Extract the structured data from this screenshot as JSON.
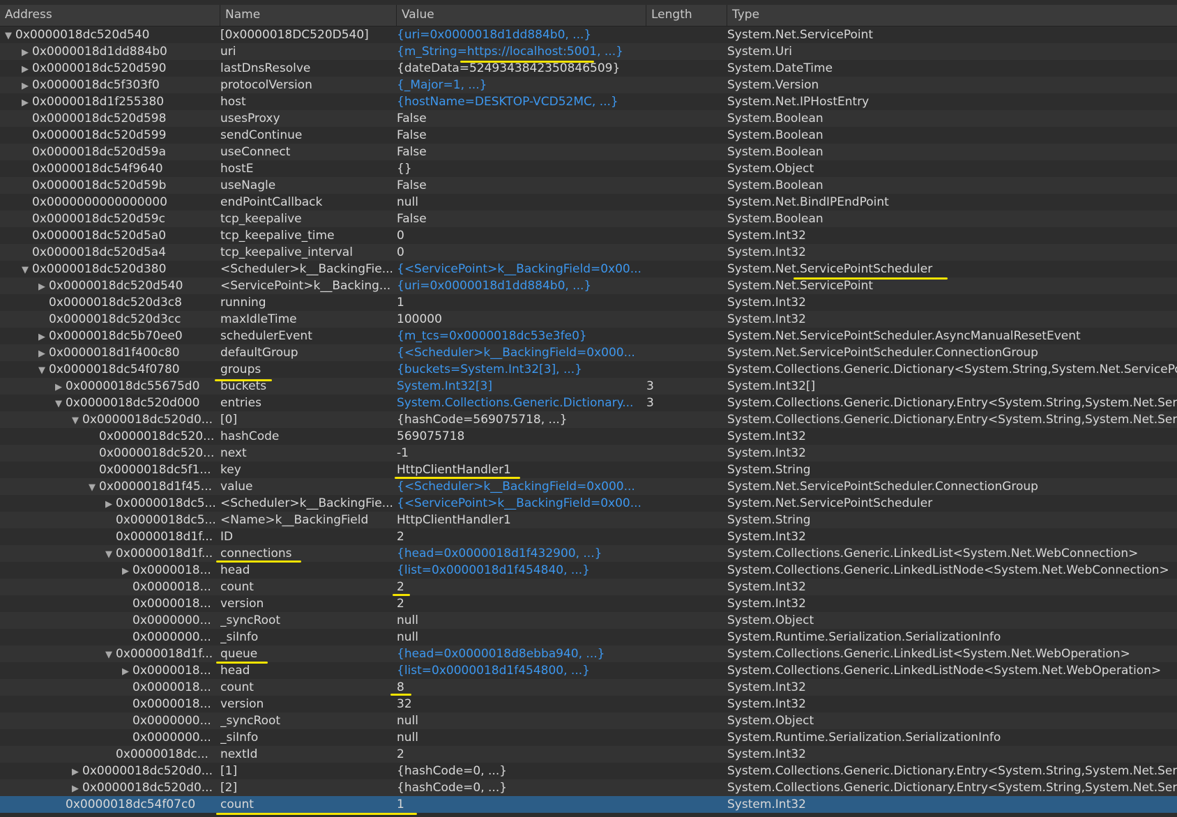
{
  "columns": [
    "Address",
    "Name",
    "Value",
    "Length",
    "Type"
  ],
  "rows": [
    {
      "depth": 0,
      "toggle": "open",
      "addr": "0x0000018dc520d540",
      "name": "[0x0000018DC520D540]",
      "value": "{uri=0x0000018d1dd884b0, ...}",
      "link": true,
      "len": "",
      "type": "System.Net.ServicePoint"
    },
    {
      "depth": 1,
      "toggle": "closed",
      "addr": "0x0000018d1dd884b0",
      "name": "uri",
      "value": "{m_String=https://localhost:5001, ...}",
      "link": true,
      "len": "",
      "type": "System.Uri"
    },
    {
      "depth": 1,
      "toggle": "closed",
      "addr": "0x0000018dc520d590",
      "name": "lastDnsResolve",
      "value": "{dateData=5249343842350846509}",
      "link": false,
      "len": "",
      "type": "System.DateTime"
    },
    {
      "depth": 1,
      "toggle": "closed",
      "addr": "0x0000018dc5f303f0",
      "name": "protocolVersion",
      "value": "{_Major=1, ...}",
      "link": true,
      "len": "",
      "type": "System.Version"
    },
    {
      "depth": 1,
      "toggle": "closed",
      "addr": "0x0000018d1f255380",
      "name": "host",
      "value": "{hostName=DESKTOP-VCD52MC, ...}",
      "link": true,
      "len": "",
      "type": "System.Net.IPHostEntry"
    },
    {
      "depth": 1,
      "toggle": "none",
      "addr": "0x0000018dc520d598",
      "name": "usesProxy",
      "value": "False",
      "link": false,
      "len": "",
      "type": "System.Boolean"
    },
    {
      "depth": 1,
      "toggle": "none",
      "addr": "0x0000018dc520d599",
      "name": "sendContinue",
      "value": "False",
      "link": false,
      "len": "",
      "type": "System.Boolean"
    },
    {
      "depth": 1,
      "toggle": "none",
      "addr": "0x0000018dc520d59a",
      "name": "useConnect",
      "value": "False",
      "link": false,
      "len": "",
      "type": "System.Boolean"
    },
    {
      "depth": 1,
      "toggle": "none",
      "addr": "0x0000018dc54f9640",
      "name": "hostE",
      "value": "{}",
      "link": false,
      "len": "",
      "type": "System.Object"
    },
    {
      "depth": 1,
      "toggle": "none",
      "addr": "0x0000018dc520d59b",
      "name": "useNagle",
      "value": "False",
      "link": false,
      "len": "",
      "type": "System.Boolean"
    },
    {
      "depth": 1,
      "toggle": "none",
      "addr": "0x0000000000000000",
      "name": "endPointCallback",
      "value": "null",
      "link": false,
      "len": "",
      "type": "System.Net.BindIPEndPoint"
    },
    {
      "depth": 1,
      "toggle": "none",
      "addr": "0x0000018dc520d59c",
      "name": "tcp_keepalive",
      "value": "False",
      "link": false,
      "len": "",
      "type": "System.Boolean"
    },
    {
      "depth": 1,
      "toggle": "none",
      "addr": "0x0000018dc520d5a0",
      "name": "tcp_keepalive_time",
      "value": "0",
      "link": false,
      "len": "",
      "type": "System.Int32"
    },
    {
      "depth": 1,
      "toggle": "none",
      "addr": "0x0000018dc520d5a4",
      "name": "tcp_keepalive_interval",
      "value": "0",
      "link": false,
      "len": "",
      "type": "System.Int32"
    },
    {
      "depth": 1,
      "toggle": "open",
      "addr": "0x0000018dc520d380",
      "name": "<Scheduler>k__BackingFie...",
      "value": "{<ServicePoint>k__BackingField=0x00...",
      "link": true,
      "len": "",
      "type": "System.Net.ServicePointScheduler"
    },
    {
      "depth": 2,
      "toggle": "closed",
      "addr": "0x0000018dc520d540",
      "name": "<ServicePoint>k__Backing...",
      "value": "{uri=0x0000018d1dd884b0, ...}",
      "link": true,
      "len": "",
      "type": "System.Net.ServicePoint"
    },
    {
      "depth": 2,
      "toggle": "none",
      "addr": "0x0000018dc520d3c8",
      "name": "running",
      "value": "1",
      "link": false,
      "len": "",
      "type": "System.Int32"
    },
    {
      "depth": 2,
      "toggle": "none",
      "addr": "0x0000018dc520d3cc",
      "name": "maxIdleTime",
      "value": "100000",
      "link": false,
      "len": "",
      "type": "System.Int32"
    },
    {
      "depth": 2,
      "toggle": "closed",
      "addr": "0x0000018dc5b70ee0",
      "name": "schedulerEvent",
      "value": "{m_tcs=0x0000018dc53e3fe0}",
      "link": true,
      "len": "",
      "type": "System.Net.ServicePointScheduler.AsyncManualResetEvent"
    },
    {
      "depth": 2,
      "toggle": "closed",
      "addr": "0x0000018d1f400c80",
      "name": "defaultGroup",
      "value": "{<Scheduler>k__BackingField=0x000...",
      "link": true,
      "len": "",
      "type": "System.Net.ServicePointScheduler.ConnectionGroup"
    },
    {
      "depth": 2,
      "toggle": "open",
      "addr": "0x0000018dc54f0780",
      "name": "groups",
      "value": "{buckets=System.Int32[3], ...}",
      "link": true,
      "len": "",
      "type": "System.Collections.Generic.Dictionary<System.String,System.Net.ServicePointScheduler.ConnectionGroup>"
    },
    {
      "depth": 3,
      "toggle": "closed",
      "addr": "0x0000018dc55675d0",
      "name": "buckets",
      "value": "System.Int32[3]",
      "link": true,
      "len": "3",
      "type": "System.Int32[]"
    },
    {
      "depth": 3,
      "toggle": "open",
      "addr": "0x0000018dc520d000",
      "name": "entries",
      "value": "System.Collections.Generic.Dictionary...",
      "link": true,
      "len": "3",
      "type": "System.Collections.Generic.Dictionary.Entry<System.String,System.Net.ServicePointScheduler.ConnectionGroup>[]"
    },
    {
      "depth": 4,
      "toggle": "open",
      "addr": "0x0000018dc520d0...",
      "name": "[0]",
      "value": "{hashCode=569075718, ...}",
      "link": false,
      "len": "",
      "type": "System.Collections.Generic.Dictionary.Entry<System.String,System.Net.ServicePointScheduler.ConnectionGroup>"
    },
    {
      "depth": 5,
      "toggle": "none",
      "addr": "0x0000018dc520...",
      "name": "hashCode",
      "value": "569075718",
      "link": false,
      "len": "",
      "type": "System.Int32"
    },
    {
      "depth": 5,
      "toggle": "none",
      "addr": "0x0000018dc520...",
      "name": "next",
      "value": "-1",
      "link": false,
      "len": "",
      "type": "System.Int32"
    },
    {
      "depth": 5,
      "toggle": "none",
      "addr": "0x0000018dc5f1...",
      "name": "key",
      "value": "HttpClientHandler1",
      "link": false,
      "len": "",
      "type": "System.String"
    },
    {
      "depth": 5,
      "toggle": "open",
      "addr": "0x0000018d1f45...",
      "name": "value",
      "value": "{<Scheduler>k__BackingField=0x000...",
      "link": true,
      "len": "",
      "type": "System.Net.ServicePointScheduler.ConnectionGroup"
    },
    {
      "depth": 6,
      "toggle": "closed",
      "addr": "0x0000018dc5...",
      "name": "<Scheduler>k__BackingFie...",
      "value": "{<ServicePoint>k__BackingField=0x00...",
      "link": true,
      "len": "",
      "type": "System.Net.ServicePointScheduler"
    },
    {
      "depth": 6,
      "toggle": "none",
      "addr": "0x0000018dc5...",
      "name": "<Name>k__BackingField",
      "value": "HttpClientHandler1",
      "link": false,
      "len": "",
      "type": "System.String"
    },
    {
      "depth": 6,
      "toggle": "none",
      "addr": "0x0000018d1f...",
      "name": "ID",
      "value": "2",
      "link": false,
      "len": "",
      "type": "System.Int32"
    },
    {
      "depth": 6,
      "toggle": "open",
      "addr": "0x0000018d1f...",
      "name": "connections",
      "value": "{head=0x0000018d1f432900, ...}",
      "link": true,
      "len": "",
      "type": "System.Collections.Generic.LinkedList<System.Net.WebConnection>"
    },
    {
      "depth": 7,
      "toggle": "closed",
      "addr": "0x0000018...",
      "name": "head",
      "value": "{list=0x0000018d1f454840, ...}",
      "link": true,
      "len": "",
      "type": "System.Collections.Generic.LinkedListNode<System.Net.WebConnection>"
    },
    {
      "depth": 7,
      "toggle": "none",
      "addr": "0x0000018...",
      "name": "count",
      "value": "2",
      "link": false,
      "len": "",
      "type": "System.Int32"
    },
    {
      "depth": 7,
      "toggle": "none",
      "addr": "0x0000018...",
      "name": "version",
      "value": "2",
      "link": false,
      "len": "",
      "type": "System.Int32"
    },
    {
      "depth": 7,
      "toggle": "none",
      "addr": "0x0000000...",
      "name": "_syncRoot",
      "value": "null",
      "link": false,
      "len": "",
      "type": "System.Object"
    },
    {
      "depth": 7,
      "toggle": "none",
      "addr": "0x0000000...",
      "name": "_siInfo",
      "value": "null",
      "link": false,
      "len": "",
      "type": "System.Runtime.Serialization.SerializationInfo"
    },
    {
      "depth": 6,
      "toggle": "open",
      "addr": "0x0000018d1f...",
      "name": "queue",
      "value": "{head=0x0000018d8ebba940, ...}",
      "link": true,
      "len": "",
      "type": "System.Collections.Generic.LinkedList<System.Net.WebOperation>"
    },
    {
      "depth": 7,
      "toggle": "closed",
      "addr": "0x0000018...",
      "name": "head",
      "value": "{list=0x0000018d1f454800, ...}",
      "link": true,
      "len": "",
      "type": "System.Collections.Generic.LinkedListNode<System.Net.WebOperation>"
    },
    {
      "depth": 7,
      "toggle": "none",
      "addr": "0x0000018...",
      "name": "count",
      "value": "8",
      "link": false,
      "len": "",
      "type": "System.Int32"
    },
    {
      "depth": 7,
      "toggle": "none",
      "addr": "0x0000018...",
      "name": "version",
      "value": "32",
      "link": false,
      "len": "",
      "type": "System.Int32"
    },
    {
      "depth": 7,
      "toggle": "none",
      "addr": "0x0000000...",
      "name": "_syncRoot",
      "value": "null",
      "link": false,
      "len": "",
      "type": "System.Object"
    },
    {
      "depth": 7,
      "toggle": "none",
      "addr": "0x0000000...",
      "name": "_siInfo",
      "value": "null",
      "link": false,
      "len": "",
      "type": "System.Runtime.Serialization.SerializationInfo"
    },
    {
      "depth": 6,
      "toggle": "none",
      "addr": "0x0000018dc...",
      "name": "nextId",
      "value": "2",
      "link": false,
      "len": "",
      "type": "System.Int32"
    },
    {
      "depth": 4,
      "toggle": "closed",
      "addr": "0x0000018dc520d0...",
      "name": "[1]",
      "value": "{hashCode=0, ...}",
      "link": false,
      "len": "",
      "type": "System.Collections.Generic.Dictionary.Entry<System.String,System.Net.ServicePointScheduler.ConnectionGroup>"
    },
    {
      "depth": 4,
      "toggle": "closed",
      "addr": "0x0000018dc520d0...",
      "name": "[2]",
      "value": "{hashCode=0, ...}",
      "link": false,
      "len": "",
      "type": "System.Collections.Generic.Dictionary.Entry<System.String,System.Net.ServicePointScheduler.ConnectionGroup>"
    },
    {
      "depth": 3,
      "toggle": "none",
      "addr": "0x0000018dc54f07c0",
      "name": "count",
      "value": "1",
      "link": false,
      "len": "",
      "type": "System.Int32",
      "selected": true
    }
  ],
  "colors": {
    "link": "#3d97ee",
    "highlight": "#f5e400",
    "selection": "#2c5d87"
  }
}
